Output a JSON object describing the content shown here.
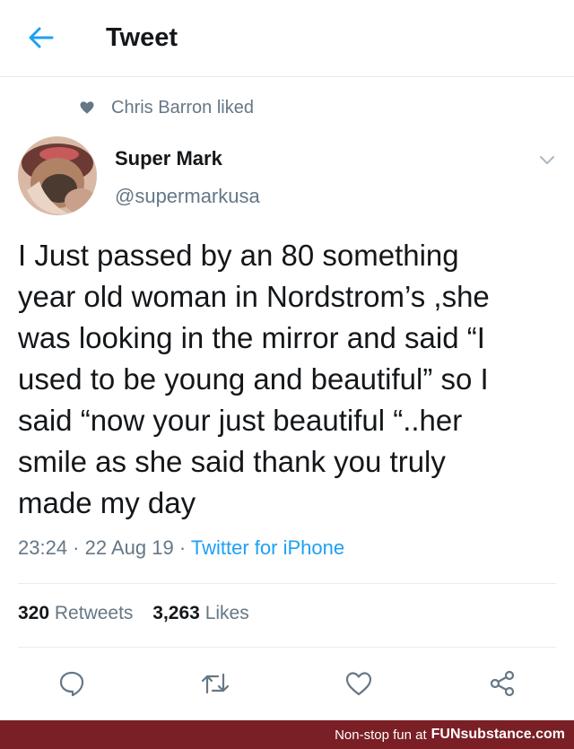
{
  "header": {
    "title": "Tweet"
  },
  "social_context": {
    "text": "Chris Barron liked"
  },
  "author": {
    "name": "Super Mark",
    "handle": "@supermarkusa"
  },
  "tweet": {
    "lines": [
      "I Just passed by an 80 something",
      "year old woman in Nordstrom’s ,she",
      "was looking in the mirror and said “I",
      "used to be young and beautiful” so I",
      "said “now your just beautiful “..her",
      "smile as she said thank you truly",
      "made my day"
    ],
    "time": "23:24",
    "date": "22 Aug 19",
    "source": "Twitter for iPhone"
  },
  "stats": {
    "retweets_count": "320",
    "retweets_label": "Retweets",
    "likes_count": "3,263",
    "likes_label": "Likes"
  },
  "footer": {
    "tagline": "Non-stop fun at",
    "brand": "FUNsubstance.com"
  },
  "colors": {
    "accent": "#1da1f2",
    "muted": "#657786",
    "footer_bg": "#7a1f25"
  },
  "icons": {
    "back": "arrow-left-icon",
    "social": "heart-icon",
    "more": "chevron-down-icon",
    "reply": "reply-icon",
    "retweet": "retweet-icon",
    "like": "heart-icon",
    "share": "share-icon"
  }
}
